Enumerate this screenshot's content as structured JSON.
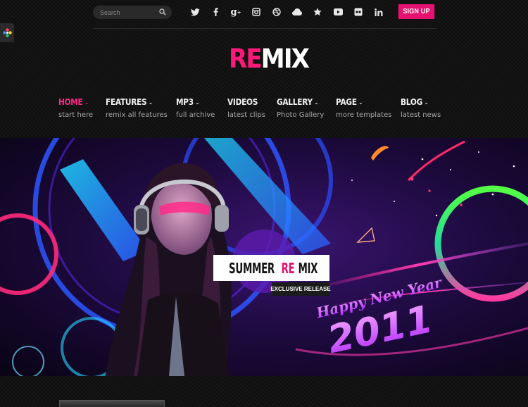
{
  "search": {
    "placeholder": "Search"
  },
  "social": [
    "twitter-icon",
    "facebook-icon",
    "google-plus-icon",
    "instagram-icon",
    "dribbble-icon",
    "cloud-icon",
    "star-icon",
    "youtube-icon",
    "flickr-icon",
    "linkedin-icon"
  ],
  "signup": {
    "label": "SIGN UP"
  },
  "logo": {
    "part1": "RE",
    "part2": "MIX"
  },
  "nav": [
    {
      "title": "HOME",
      "sub": "start here",
      "caret": "⌄"
    },
    {
      "title": "FEATURES",
      "sub": "remix all features",
      "caret": "⌄"
    },
    {
      "title": "MP3",
      "sub": "full archive",
      "caret": "⌄"
    },
    {
      "title": "VIDEOS",
      "sub": "latest clips",
      "caret": ""
    },
    {
      "title": "GALLERY",
      "sub": "Photo Gallery",
      "caret": "⌄"
    },
    {
      "title": "PAGE",
      "sub": "more templates",
      "caret": "⌄"
    },
    {
      "title": "BLOG",
      "sub": "latest news",
      "caret": "⌄"
    }
  ],
  "slide": {
    "title_part1": "SUMMER ",
    "title_part2": "RE",
    "title_part3": "MIX",
    "badge": "EXCLUSIVE RELEASE",
    "art_line1": "Happy New Year",
    "art_line2": "2011"
  },
  "colors": {
    "accent": "#e5136f",
    "logo_pink": "#ff1a7a",
    "background": "#121212"
  }
}
